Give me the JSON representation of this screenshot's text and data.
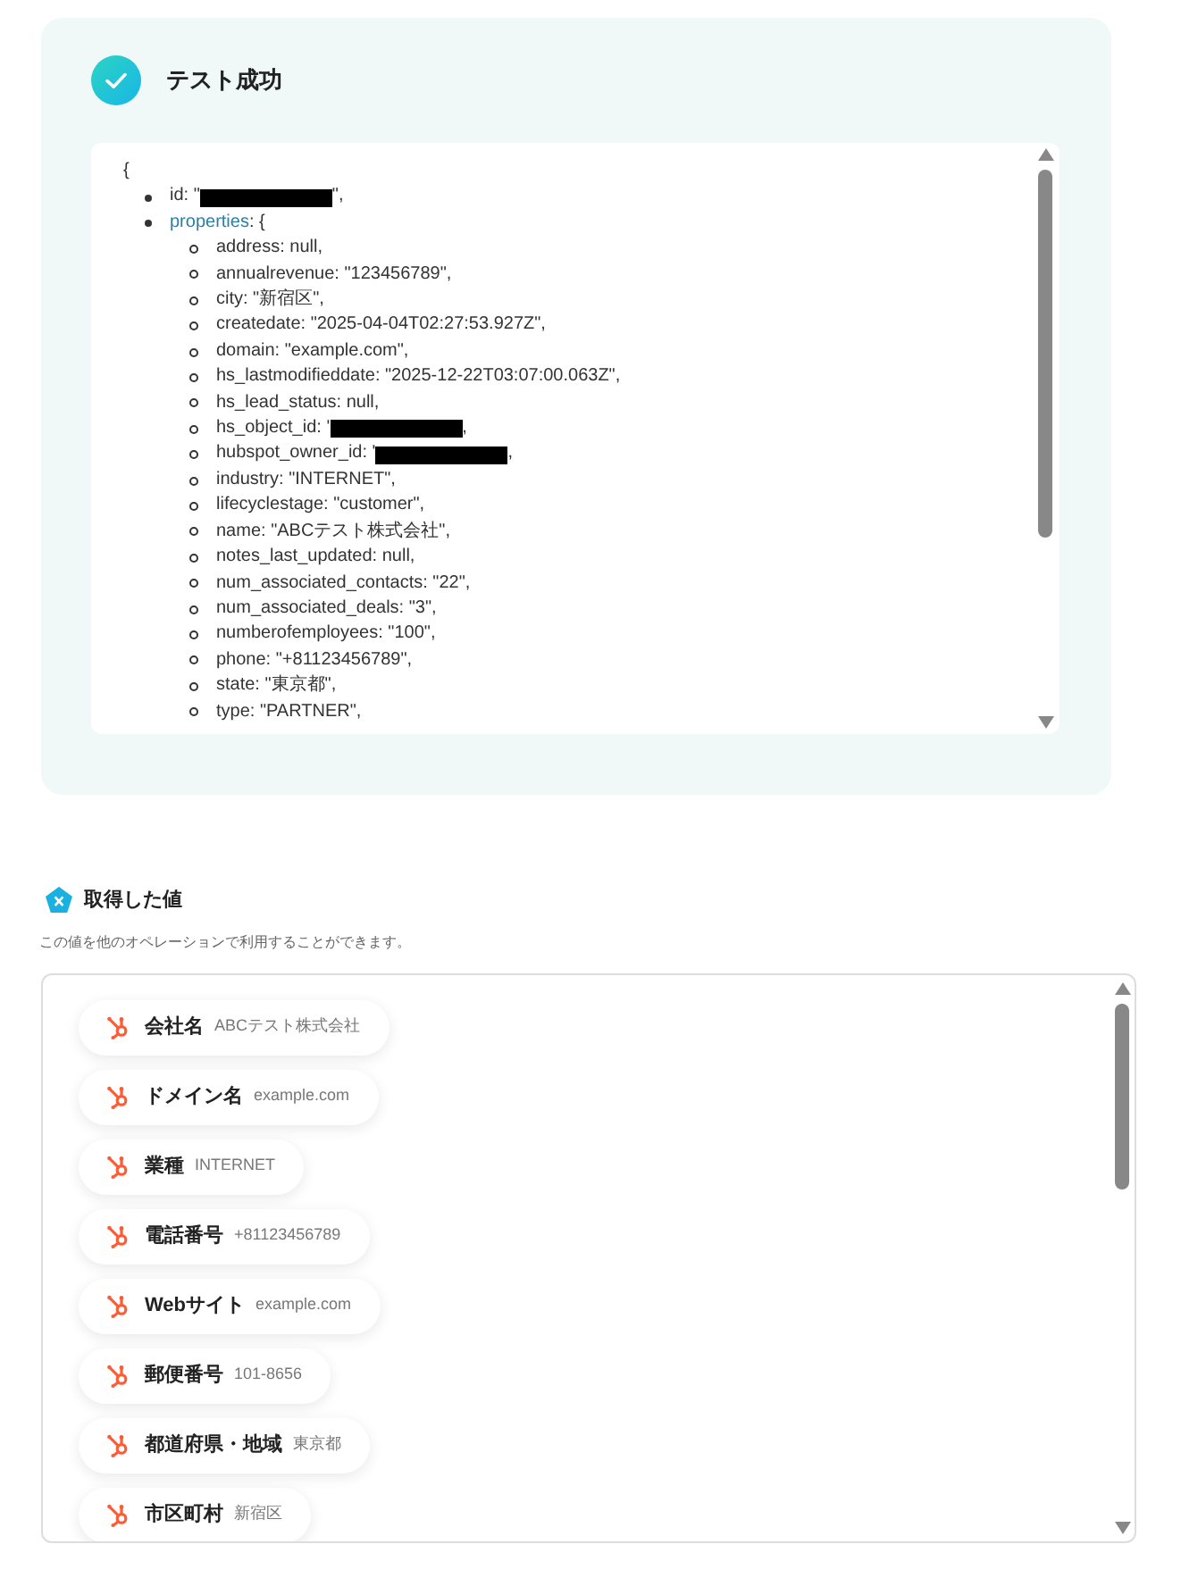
{
  "test_result": {
    "title": "テスト成功",
    "json_preview": {
      "open": "{",
      "id_line": {
        "text": "id: \"",
        "after": "\",",
        "redacted": true
      },
      "properties_key": "properties",
      "properties_open": ": {",
      "properties": [
        {
          "text": "address: null,",
          "redacted": false
        },
        {
          "text": "annualrevenue: \"123456789\",",
          "redacted": false
        },
        {
          "text": "city: \"新宿区\",",
          "redacted": false
        },
        {
          "text": "createdate: \"2025-04-04T02:27:53.927Z\",",
          "redacted": false
        },
        {
          "text": "domain: \"example.com\",",
          "redacted": false
        },
        {
          "text": "hs_lastmodifieddate: \"2025-12-22T03:07:00.063Z\",",
          "redacted": false
        },
        {
          "text": "hs_lead_status: null,",
          "redacted": false
        },
        {
          "text": "hs_object_id: '",
          "after": ",",
          "redacted": true
        },
        {
          "text": "hubspot_owner_id: '",
          "after": ",",
          "redacted": true
        },
        {
          "text": "industry: \"INTERNET\",",
          "redacted": false
        },
        {
          "text": "lifecyclestage: \"customer\",",
          "redacted": false
        },
        {
          "text": "name: \"ABCテスト株式会社\",",
          "redacted": false
        },
        {
          "text": "notes_last_updated: null,",
          "redacted": false
        },
        {
          "text": "num_associated_contacts: \"22\",",
          "redacted": false
        },
        {
          "text": "num_associated_deals: \"3\",",
          "redacted": false
        },
        {
          "text": "numberofemployees: \"100\",",
          "redacted": false
        },
        {
          "text": "phone: \"+81123456789\",",
          "redacted": false
        },
        {
          "text": "state: \"東京都\",",
          "redacted": false
        },
        {
          "text": "type: \"PARTNER\",",
          "redacted": false
        }
      ]
    }
  },
  "fetched_values": {
    "title": "取得した値",
    "description": "この値を他のオペレーションで利用することができます。",
    "items": [
      {
        "label": "会社名",
        "value": "ABCテスト株式会社"
      },
      {
        "label": "ドメイン名",
        "value": "example.com"
      },
      {
        "label": "業種",
        "value": "INTERNET"
      },
      {
        "label": "電話番号",
        "value": "+81123456789"
      },
      {
        "label": "Webサイト",
        "value": "example.com"
      },
      {
        "label": "郵便番号",
        "value": "101-8656"
      },
      {
        "label": "都道府県・地域",
        "value": "東京都"
      },
      {
        "label": "市区町村",
        "value": "新宿区"
      }
    ]
  }
}
